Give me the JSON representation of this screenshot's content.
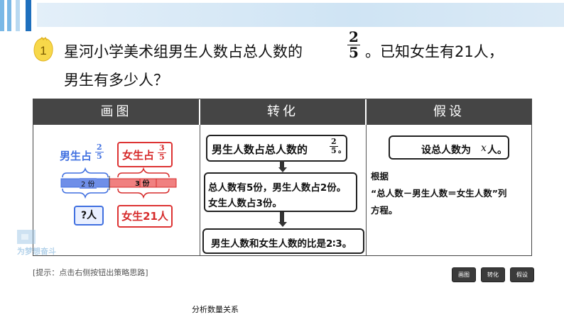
{
  "question": {
    "number": "1",
    "text_before": "星河小学美术组男生人数占总人数的",
    "fraction": {
      "numerator": "2",
      "denominator": "5"
    },
    "text_after": "。已知女生有21人，",
    "line2": "男生有多少人？"
  },
  "table": {
    "headers": [
      "画图",
      "转化",
      "假设"
    ],
    "drawing": {
      "boy_label": "男生占",
      "boy_fraction": {
        "numerator": "2",
        "denominator": "5"
      },
      "girl_label": "女生占",
      "girl_fraction": {
        "numerator": "3",
        "denominator": "5"
      },
      "boy_parts": "2 份",
      "girl_parts": "3 份",
      "boy_count": "?人",
      "girl_count": "女生21人"
    },
    "transform": {
      "step1": "男生人数占总人数的",
      "step1_fraction": {
        "numerator": "2",
        "denominator": "5"
      },
      "step1_end": "。",
      "step2_line1": "总人数有5份，男生人数占2份。",
      "step2_line2": "女生人数占3份。",
      "step3": "男生人数和女生人数的比是2∶3。"
    },
    "assume": {
      "box_text_before": "设总人数为",
      "box_var": "x",
      "box_text_after": "人。",
      "line1": "根据",
      "line2": "“总人数－男生人数＝女生人数”列",
      "line3": "方程。"
    }
  },
  "hint": "[提示：点击右侧按钮出策略思路]",
  "buttons": [
    "画图",
    "转化",
    "假设"
  ],
  "footer": "分析数量关系",
  "watermark": "为梦想奋斗",
  "colors": {
    "boy_blue": "#3f6fe0",
    "girl_red": "#d62b2b",
    "header_bg": "#454545",
    "accent_blue": "#1e6fbd"
  }
}
